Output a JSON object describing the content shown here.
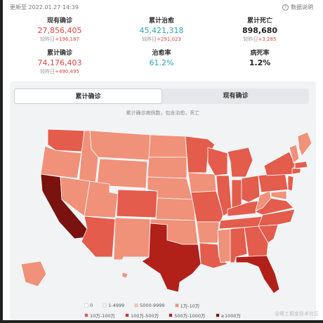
{
  "header": {
    "updated": "更新至 2022.01.27 14:39",
    "explain": "数据说明"
  },
  "stats": [
    {
      "label": "现有确诊",
      "value": "27,856,405",
      "delta_prefix": "较昨日",
      "delta": "+196,187"
    },
    {
      "label": "累计治愈",
      "value": "45,421,318",
      "delta_prefix": "较昨日",
      "delta": "+291,023"
    },
    {
      "label": "累计死亡",
      "value": "898,680",
      "delta_prefix": "较昨日",
      "delta": "+3,285"
    },
    {
      "label": "累计确诊",
      "value": "74,176,403",
      "delta_prefix": "较昨日",
      "delta": "+490,495"
    },
    {
      "label": "治愈率",
      "value": "61.2%"
    },
    {
      "label": "病死率",
      "value": "1.2%"
    }
  ],
  "tabs": [
    {
      "label": "累计确诊",
      "active": true
    },
    {
      "label": "现有确诊",
      "active": false
    }
  ],
  "map": {
    "subtitle": "累计确诊病例数，包含治愈、死亡",
    "colors": {
      "c0": "#ffffff",
      "c1": "#fdf0e6",
      "c2": "#f7c4b0",
      "c3": "#f0917a",
      "c4": "#e35c4c",
      "c5": "#cc3a2d",
      "c6": "#b1211a",
      "c7": "#7a1210"
    }
  },
  "legend": {
    "items": [
      {
        "label": "0",
        "color": "#ffffff"
      },
      {
        "label": "1-4999",
        "color": "#fdf0e6"
      },
      {
        "label": "5000-9999",
        "color": "#f7c4b0"
      },
      {
        "label": "1万-10万",
        "color": "#f0917a"
      },
      {
        "label": "10万-100万",
        "color": "#e35c4c"
      },
      {
        "label": "100万-500万",
        "color": "#cc3a2d"
      },
      {
        "label": "500万-1000万",
        "color": "#b1211a"
      },
      {
        "label": "≥1000万",
        "color": "#7a1210"
      }
    ]
  },
  "watermark": "@稀土掘金技术社区"
}
